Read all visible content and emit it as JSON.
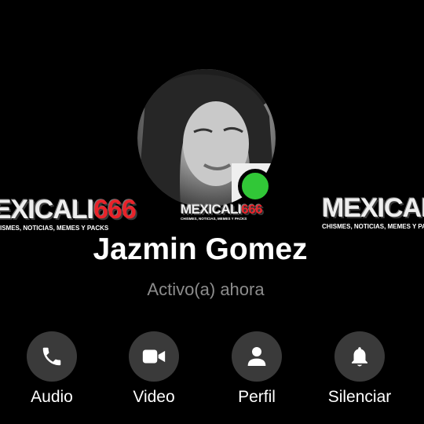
{
  "contact": {
    "name": "Jazmin Gomez",
    "status": "Activo(a) ahora",
    "online_color": "#31c737"
  },
  "watermark": {
    "brand_text": "MEXICALI",
    "brand_number": "666",
    "tagline": "CHISMES, NOTICIAS, MEMES Y PACKS",
    "left_text": "EXICALI",
    "left_tagline": "ISMES, NOTICIAS, MEMES Y PACKS",
    "right_text": "MEXICALI",
    "right_tagline": "CHISMES, NOTICIAS, MEMES Y PACKS"
  },
  "actions": [
    {
      "label": "Audio",
      "icon": "phone-icon"
    },
    {
      "label": "Video",
      "icon": "video-camera-icon"
    },
    {
      "label": "Perfil",
      "icon": "person-icon"
    },
    {
      "label": "Silenciar",
      "icon": "bell-icon"
    }
  ],
  "colors": {
    "background": "#000000",
    "button_bg": "#3a3a3a",
    "status_text": "#8c8c8c",
    "watermark_accent": "#e8232a"
  }
}
